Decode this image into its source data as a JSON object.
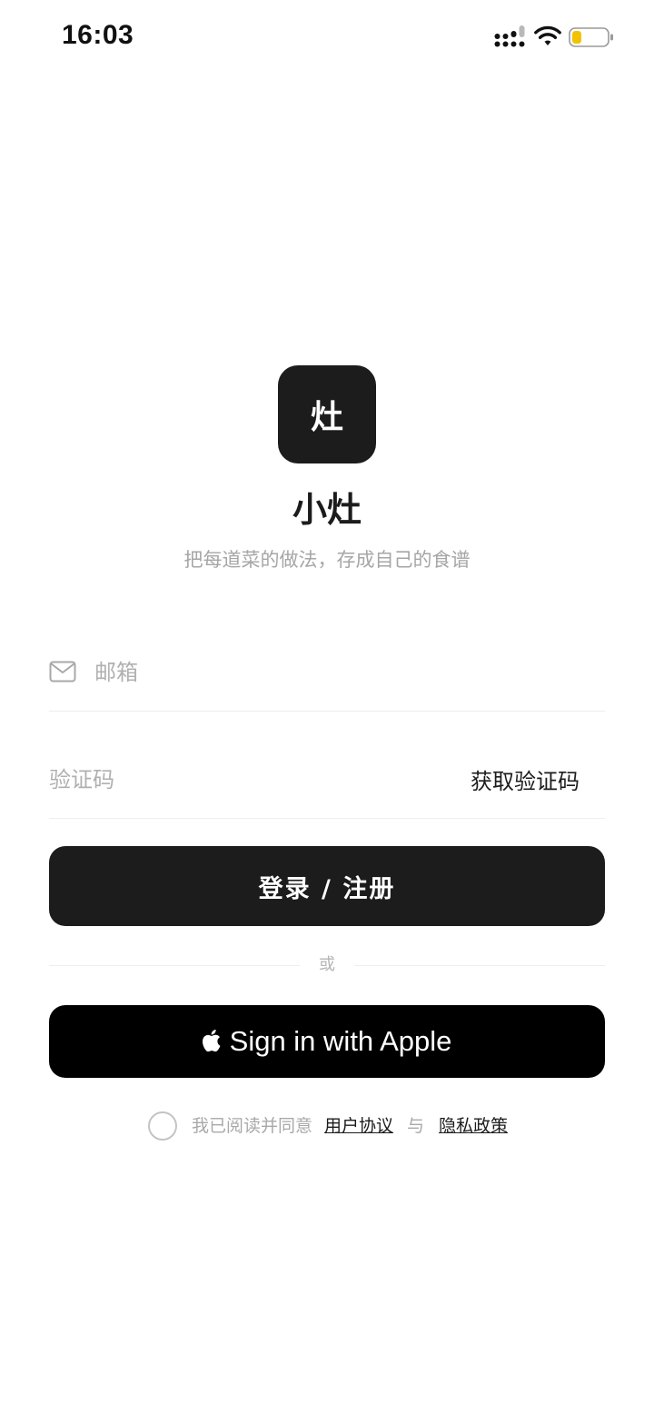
{
  "status_bar": {
    "time": "16:03",
    "signal_icon": "cellular-signal-icon",
    "wifi_icon": "wifi-icon",
    "battery_icon": "battery-low-icon",
    "battery_color": "#f2c200"
  },
  "brand": {
    "logo_char": "灶",
    "app_name": "小灶",
    "slogan": "把每道菜的做法，存成自己的食谱"
  },
  "form": {
    "email_icon": "mail-icon",
    "email_placeholder": "邮箱",
    "email_value": "",
    "code_placeholder": "验证码",
    "code_value": "",
    "get_code_label": "获取验证码",
    "login_button_label": "登录 / 注册",
    "divider_text": "或",
    "apple_icon": "apple-logo-icon",
    "apple_button_label": "Sign in with Apple"
  },
  "agreement": {
    "checked": false,
    "prefix": "我已阅读并同意",
    "terms_label": "用户协议",
    "and_text": "与",
    "privacy_label": "隐私政策"
  },
  "colors": {
    "primary": "#1c1c1c",
    "apple_button": "#000000",
    "muted_text": "#a6a6a6",
    "background": "#ffffff"
  }
}
